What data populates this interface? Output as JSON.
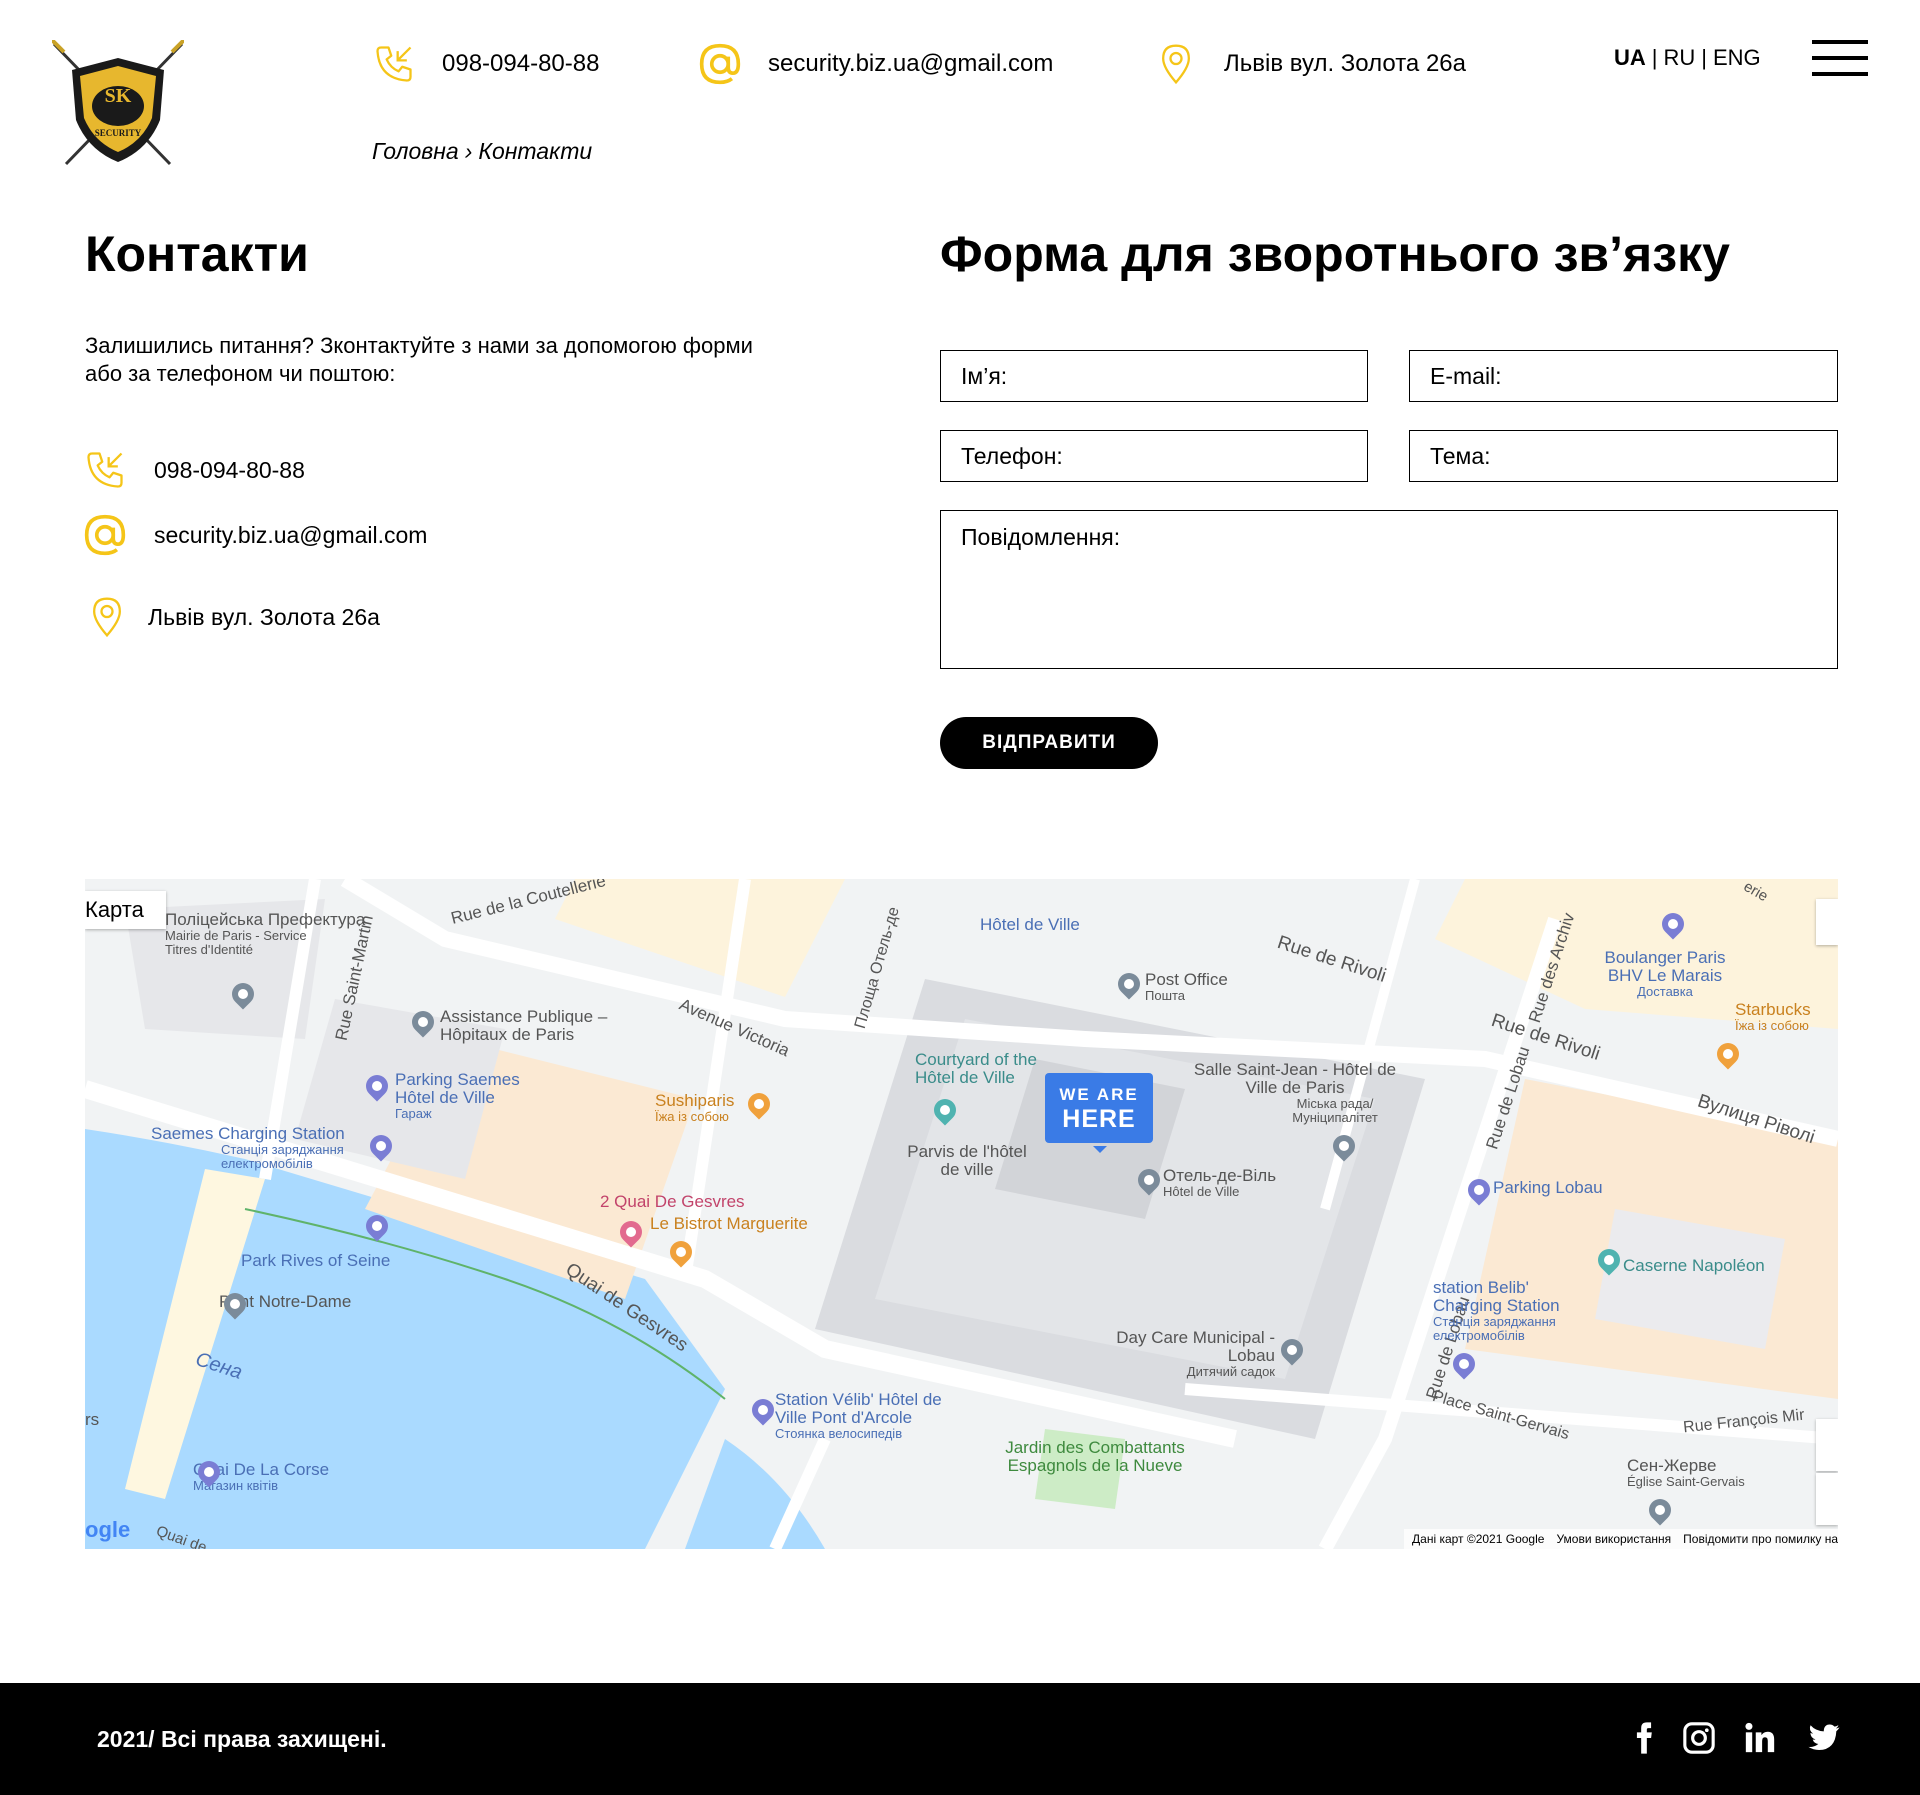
{
  "header": {
    "logo_text": "SK",
    "logo_subtext": "SECURITY",
    "phone": "098-094-80-88",
    "email": "security.biz.ua@gmail.com",
    "address": "Львів вул. Золота 26а",
    "languages": [
      "UA",
      "RU",
      "ENG"
    ],
    "lang_separator": "|",
    "active_language": "UA"
  },
  "breadcrumb": {
    "home": "Головна",
    "separator": "›",
    "current": "Контакти"
  },
  "contacts": {
    "title": "Контакти",
    "intro": "Залишились питання? Зконтактуйте з нами за допомогою форми або за телефоном чи поштою:",
    "phone": "098-094-80-88",
    "email": "security.biz.ua@gmail.com",
    "address": "Львів вул. Золота 26а"
  },
  "form": {
    "title": "Форма для зворотнього зв’язку",
    "name_placeholder": "Ім’я:",
    "email_placeholder": "E-mail:",
    "phone_placeholder": "Телефон:",
    "topic_placeholder": "Тема:",
    "message_placeholder": "Повідомлення:",
    "submit_label": "ВІДПРАВИТИ"
  },
  "map": {
    "tab_label": "Карта",
    "marker_line1": "WE ARE",
    "marker_line2": "HERE",
    "labels": {
      "prefecture": "Поліцейська Префектура",
      "prefecture_sub": "Mairie de Paris - Service Titres d'Identité",
      "hotel_de_ville_metro": "Hôtel de Ville",
      "rue_rivoli": "Rue de Rivoli",
      "rue_rivoli2": "Rue de Rivoli",
      "vulytsia_rivoli": "Вулиця Ріволі",
      "rue_coutellerie": "Rue de la Coutellerie",
      "place_hotel_de_ville": "Площа Отель-де",
      "avenue_victoria": "Avenue Victoria",
      "rue_saint_martin": "Rue Saint-Martin",
      "assistance": "Assistance Publique – Hôpitaux de Paris",
      "parking_saemes": "Parking Saemes Hôtel de Ville",
      "parking_saemes_sub": "Гараж",
      "saemes_charging": "Saemes Charging Station",
      "saemes_charging_sub": "Станція заряджання електромобілів",
      "sushiparis": "Sushiparis",
      "sushiparis_sub": "Їжа із собою",
      "quai_gesvres_2": "2 Quai De Gesvres",
      "bistrot": "Le Bistrot Marguerite",
      "courtyard": "Courtyard of the Hôtel de Ville",
      "parvis": "Parvis de l'hôtel de ville",
      "post_office": "Post Office",
      "post_office_sub": "Пошта",
      "salle_saint_jean": "Salle Saint-Jean - Hôtel de Ville de Paris",
      "salle_saint_jean_sub": "Міська рада/ Муніципалітет",
      "otel_de_vil": "Отель-де-Віль",
      "otel_de_vil_sub": "Hôtel de Ville",
      "boulanger": "Boulanger Paris BHV Le Marais",
      "boulanger_sub": "Доставка",
      "starbucks": "Starbucks",
      "starbucks_sub": "Їжа із собою",
      "rue_archives": "Rue des Archiv",
      "rue_lobau": "Rue de Lobau",
      "rue_lobau2": "Rue de Lobau",
      "parking_lobau": "Parking Lobau",
      "caserne": "Caserne Napoléon",
      "station_belib": "station Belib' Charging Station",
      "station_belib_sub": "Станція заряджання електромобілів",
      "park_rives": "Park Rives of Seine",
      "pont_notre_dame": "Pont Notre-Dame",
      "sena": "Сена",
      "quai_gesvres": "Quai de Gesvres",
      "velib": "Station Vélib' Hôtel de Ville Pont d'Arcole",
      "velib_sub": "Стоянка велосипедів",
      "day_care": "Day Care Municipal - Lobau",
      "day_care_sub": "Дитячий садок",
      "jardin": "Jardin des Combattants Espagnols de la Nueve",
      "place_saint_gervais": "Place Saint-Gervais",
      "rue_francois_miron": "Rue François Mir",
      "sen_zherve": "Сен-Жерве",
      "sen_zherve_sub": "Église Saint-Gervais",
      "quai_de_la_corse": "Quai De La Corse",
      "quai_de_la_corse_sub": "Магазин квітів",
      "rue_erie": "erie",
      "rs": "rs",
      "quai_de": "Quai de",
      "google": "ogle"
    },
    "footer": {
      "data": "Дані карт ©2021 Google",
      "terms": "Умови використання",
      "report": "Повідомити про помилку на"
    }
  },
  "footer": {
    "copyright": "2021/ Всі права захищені.",
    "social": [
      "facebook-icon",
      "instagram-icon",
      "linkedin-icon",
      "twitter-icon"
    ]
  },
  "colors": {
    "accent": "#F5C518",
    "map_water": "#aadaff",
    "map_marker": "#3a7be6",
    "footer_bg": "#000000"
  }
}
